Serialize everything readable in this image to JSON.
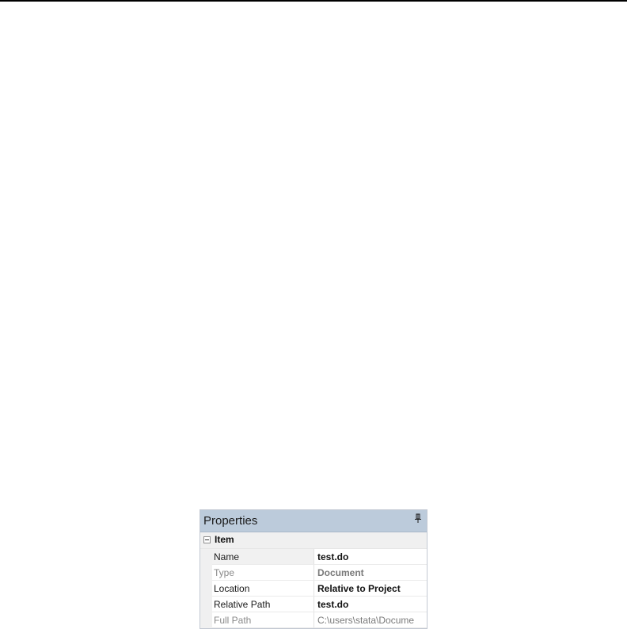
{
  "panel": {
    "title": "Properties",
    "pin_icon": "pin-icon"
  },
  "category": {
    "label": "Item",
    "toggle_icon": "collapse-minus-icon"
  },
  "properties": [
    {
      "name": "Name",
      "value": "test.do"
    },
    {
      "name": "Type",
      "value": "Document"
    },
    {
      "name": "Location",
      "value": "Relative to Project"
    },
    {
      "name": "Relative Path",
      "value": "test.do"
    },
    {
      "name": "Full Path",
      "value": "C:\\users\\stata\\Docume"
    }
  ],
  "colors": {
    "title_bar": "#bccbdb",
    "border": "#c2c8d2",
    "readonly_text": "#8a8a8a"
  }
}
